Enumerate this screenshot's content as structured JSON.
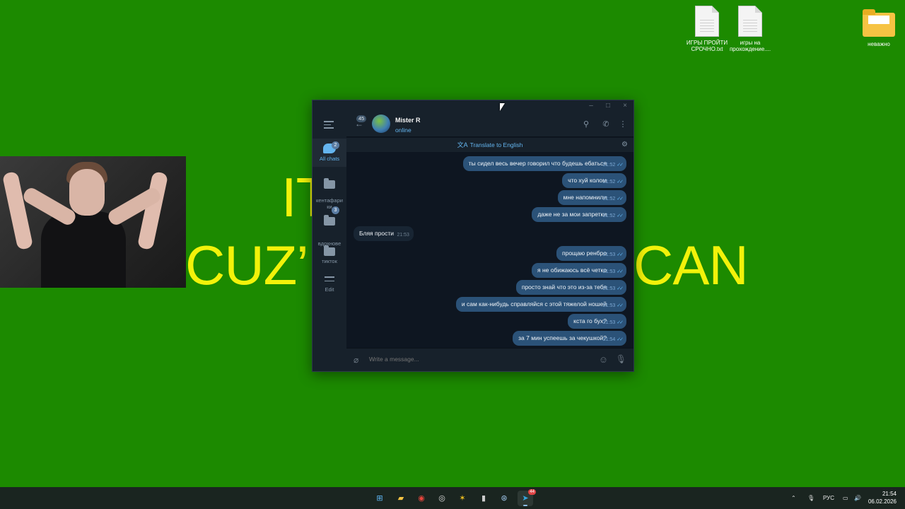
{
  "desktop": {
    "icons": [
      {
        "label": "ИГРЫ ПРОЙТИ СРОЧНО.txt",
        "kind": "text-file-icon"
      },
      {
        "label": "игры на прохождение....",
        "kind": "text-file-icon"
      },
      {
        "label": "неважно",
        "kind": "folder-icon"
      }
    ],
    "background_text": {
      "line1": "IT",
      "line2a": "CUZ’",
      "line2b": "CAN"
    },
    "background_color": "#1c8a00"
  },
  "telegram": {
    "folders": [
      {
        "label": "All chats",
        "badge": "2"
      },
      {
        "label": "кентафари\nки",
        "badge": ""
      },
      {
        "label": "вдохнове\nние",
        "badge": "3"
      },
      {
        "label": "тикток",
        "badge": ""
      },
      {
        "label": "Edit",
        "badge": ""
      }
    ],
    "header": {
      "unread": "45",
      "name": "Mister R",
      "status": "online"
    },
    "translate_label": "Translate to English",
    "messages": [
      {
        "dir": "out",
        "text": "ты сидел весь вечер говорил что будешь ебаться",
        "time": "21:52"
      },
      {
        "dir": "out",
        "text": "что хуй колом",
        "time": "21:52"
      },
      {
        "dir": "out",
        "text": "мне напомнили",
        "time": "21:52"
      },
      {
        "dir": "out",
        "text": "даже не за мои запретки",
        "time": "21:52"
      },
      {
        "dir": "in",
        "text": "Бляя прости",
        "time": "21:53"
      },
      {
        "dir": "out",
        "text": "прощаю ренбро",
        "time": "21:53"
      },
      {
        "dir": "out",
        "text": "я не обижаюсь всё четко",
        "time": "21:53"
      },
      {
        "dir": "out",
        "text": "просто знай что это из-за тебя",
        "time": "21:53"
      },
      {
        "dir": "out",
        "text": "и сам как-нибудь справляйся с этой тяжелой ношей",
        "time": "21:53"
      },
      {
        "dir": "out",
        "text": "кста го бух?",
        "time": "21:53"
      },
      {
        "dir": "out",
        "text": "за 7 мин успеешь за чекушкой?",
        "time": "21:54"
      }
    ],
    "input_placeholder": "Write a message...",
    "colors": {
      "accent": "#64b5ef",
      "outgoing_bubble": "#2b5278",
      "background": "#0e1621"
    }
  },
  "taskbar": {
    "apps": [
      "windows-start-icon",
      "file-explorer-icon",
      "chrome-icon",
      "obs-icon",
      "game-icon",
      "app-icon",
      "steam-icon",
      "telegram-icon"
    ],
    "telegram_badge": "44",
    "language": "РУС",
    "time": "21:54",
    "date": "06.02.2026"
  }
}
